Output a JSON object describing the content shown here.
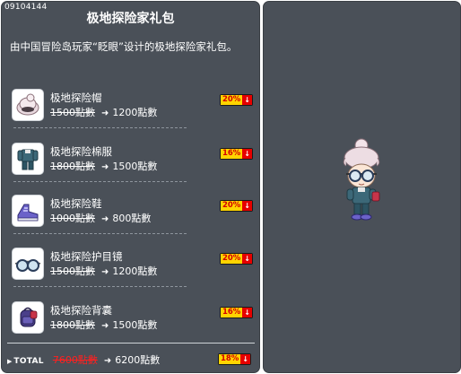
{
  "item_code": "09104144",
  "title": "极地探险家礼包",
  "description": "由中国冒险岛玩家“眨眼”设计的极地探险家礼包。",
  "items": [
    {
      "name": "极地探险帽",
      "old_price": "1500點數",
      "new_price": "1200點數",
      "discount": "20%",
      "icon": "fur-hat-icon"
    },
    {
      "name": "极地探险棉服",
      "old_price": "1800點數",
      "new_price": "1500點數",
      "discount": "16%",
      "icon": "padded-coat-icon"
    },
    {
      "name": "极地探险鞋",
      "old_price": "1000點數",
      "new_price": "800點數",
      "discount": "20%",
      "icon": "snow-boots-icon"
    },
    {
      "name": "极地探险护目镜",
      "old_price": "1500點數",
      "new_price": "1200點數",
      "discount": "20%",
      "icon": "goggles-icon"
    },
    {
      "name": "极地探险背囊",
      "old_price": "1800點數",
      "new_price": "1500點數",
      "discount": "16%",
      "icon": "backpack-icon"
    }
  ],
  "total": {
    "label": "TOTAL",
    "old_price": "7600點數",
    "new_price": "6200點數",
    "discount": "18%"
  },
  "arrow_glyph": "➜",
  "down_glyph": "↓",
  "colors": {
    "panel_bg": "#4a5058",
    "badge_yellow": "#ffd400",
    "badge_red": "#e60000",
    "old_total_red": "#ff2020"
  }
}
